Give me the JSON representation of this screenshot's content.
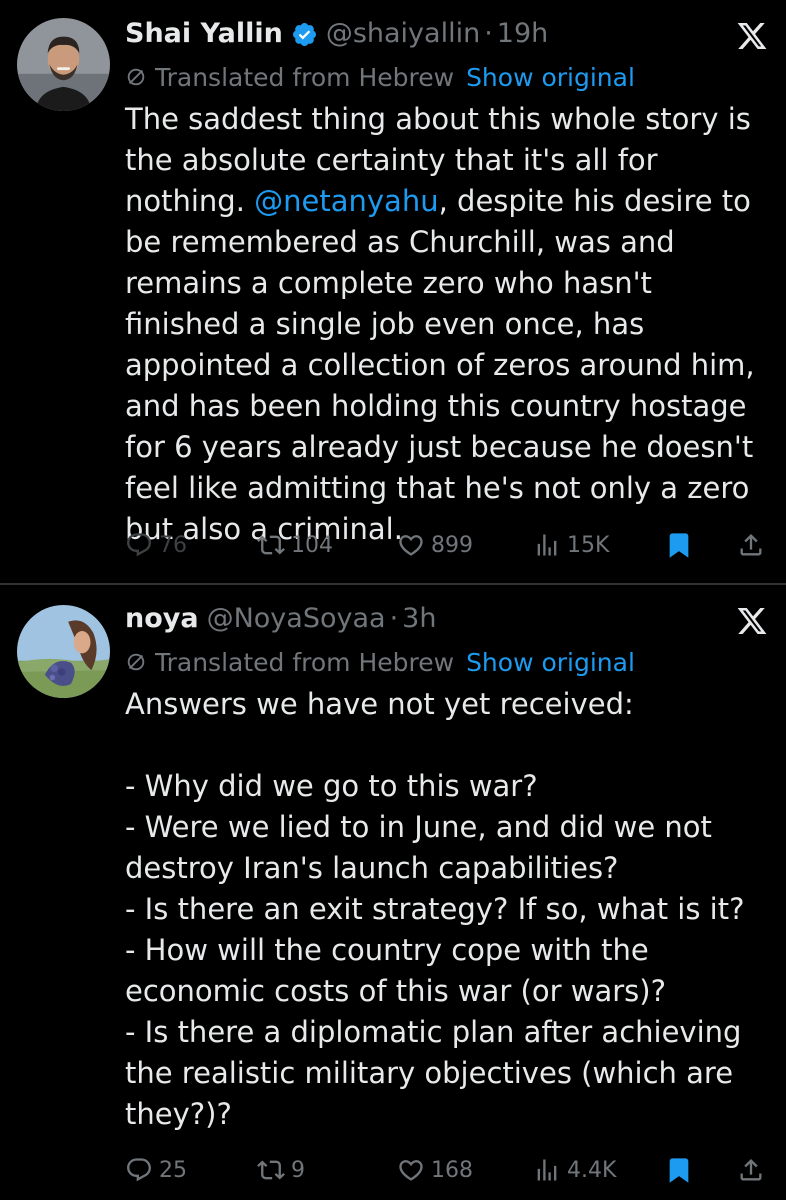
{
  "tweets": [
    {
      "name": "Shai Yallin",
      "verified": true,
      "handle": "@shaiyallin",
      "separator": "·",
      "time": "19h",
      "translated_label": "Translated from Hebrew",
      "show_original": "Show original",
      "mention": "@netanyahu",
      "body_before_mention": "The saddest thing about this whole story is the absolute certainty that it's all for nothing. ",
      "body_after_mention": ", despite his desire to be remembered as Churchill, was and remains a complete zero who hasn't finished a single job even once, has appointed a collection of zeros around him, and has been holding this country hostage for 6 years already just because he doesn't feel like admitting that he's not only a zero but also a criminal.",
      "stats": {
        "replies": "76",
        "reposts": "104",
        "likes": "899",
        "views": "15K"
      }
    },
    {
      "name": "noya",
      "verified": false,
      "handle": "@NoyaSoyaa",
      "separator": "·",
      "time": "3h",
      "translated_label": "Translated from Hebrew",
      "show_original": "Show original",
      "body": "Answers we have not yet received:\n\n- Why did we go to this war?\n- Were we lied to in June, and did we not destroy Iran's launch capabilities?\n- Is there an exit strategy? If so, what is it?\n- How will the country cope with the economic costs of this war (or wars)?\n- Is there a diplomatic plan after achieving the realistic military objectives (which are they?)?",
      "stats": {
        "replies": "25",
        "reposts": "9",
        "likes": "168",
        "views": "4.4K"
      }
    }
  ],
  "icons": {
    "verified": "verified-badge-icon",
    "platform": "x-logo-icon",
    "translate": "translate-globe-icon",
    "reply": "reply-icon",
    "repost": "repost-icon",
    "like": "heart-icon",
    "views": "views-chart-icon",
    "bookmark": "bookmark-icon",
    "share": "share-icon"
  },
  "colors": {
    "background": "#000000",
    "text": "#e7e9ea",
    "secondary": "#71767b",
    "link": "#1d9bf0",
    "bookmark_active": "#1d9bf0",
    "divider": "#2f3336"
  }
}
